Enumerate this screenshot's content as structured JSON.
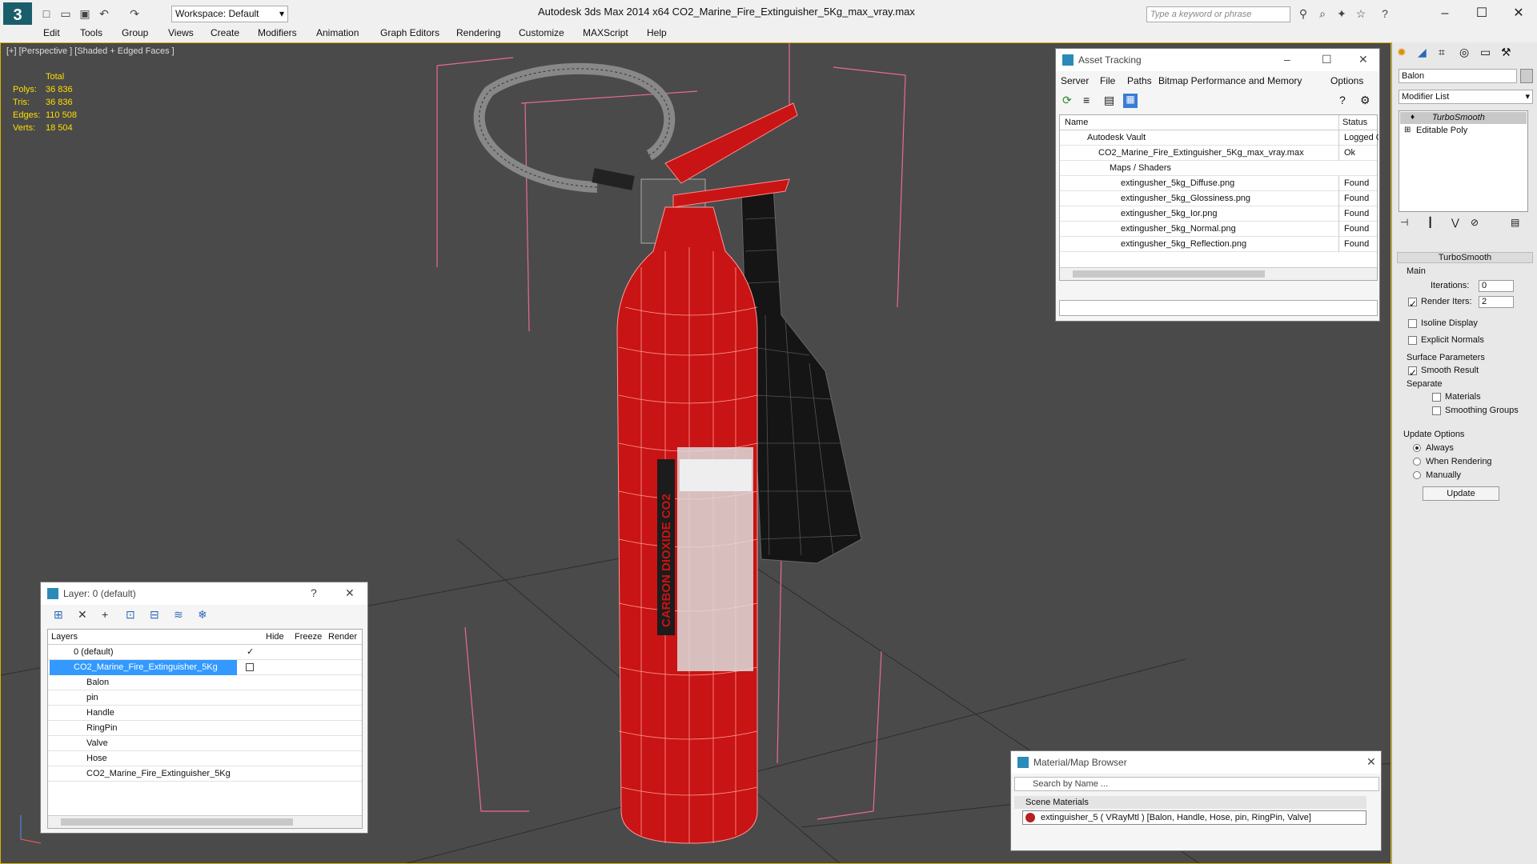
{
  "titlebar": {
    "workspace": "Workspace: Default",
    "title": "Autodesk 3ds Max  2014 x64       CO2_Marine_Fire_Extinguisher_5Kg_max_vray.max",
    "search_placeholder": "Type a keyword or phrase"
  },
  "menu": [
    "Edit",
    "Tools",
    "Group",
    "Views",
    "Create",
    "Modifiers",
    "Animation",
    "Graph Editors",
    "Rendering",
    "Customize",
    "MAXScript",
    "Help"
  ],
  "viewport": {
    "label": "[+] [Perspective ] [Shaded + Edged Faces ]",
    "stats_header": "Total",
    "stats": [
      {
        "label": "Polys:",
        "value": "36 836"
      },
      {
        "label": "Tris:",
        "value": "36 836"
      },
      {
        "label": "Edges:",
        "value": "110 508"
      },
      {
        "label": "Verts:",
        "value": "18 504"
      }
    ],
    "label_text": "CARBON DIOXIDE CO2"
  },
  "asset_tracking": {
    "title": "Asset Tracking",
    "menu": [
      "Server",
      "File",
      "Paths",
      "Bitmap Performance and Memory",
      "Options"
    ],
    "col_name": "Name",
    "col_status": "Status",
    "rows": [
      {
        "name": "Autodesk Vault",
        "status": "Logged O"
      },
      {
        "name": "CO2_Marine_Fire_Extinguisher_5Kg_max_vray.max",
        "status": "Ok"
      },
      {
        "name": "Maps / Shaders",
        "status": ""
      },
      {
        "name": "extingusher_5kg_Diffuse.png",
        "status": "Found"
      },
      {
        "name": "extingusher_5kg_Glossiness.png",
        "status": "Found"
      },
      {
        "name": "extingusher_5kg_Ior.png",
        "status": "Found"
      },
      {
        "name": "extingusher_5kg_Normal.png",
        "status": "Found"
      },
      {
        "name": "extingusher_5kg_Reflection.png",
        "status": "Found"
      }
    ]
  },
  "layer_panel": {
    "title": "Layer: 0 (default)",
    "help": "?",
    "col_layers": "Layers",
    "col_hide": "Hide",
    "col_freeze": "Freeze",
    "col_render": "Render",
    "rows": [
      {
        "name": "0 (default)"
      },
      {
        "name": "CO2_Marine_Fire_Extinguisher_5Kg"
      },
      {
        "name": "Balon"
      },
      {
        "name": "pin"
      },
      {
        "name": "Handle"
      },
      {
        "name": "RingPin"
      },
      {
        "name": "Valve"
      },
      {
        "name": "Hose"
      },
      {
        "name": "CO2_Marine_Fire_Extinguisher_5Kg"
      }
    ]
  },
  "material_browser": {
    "title": "Material/Map Browser",
    "search_placeholder": "Search by Name ...",
    "section": "Scene Materials",
    "item": "extinguisher_5  ( VRayMtl )  [Balon, Handle, Hose, pin, RingPin, Valve]"
  },
  "command_panel": {
    "object_name": "Balon",
    "modifier_list": "Modifier List",
    "stack": [
      "TurboSmooth",
      "Editable Poly"
    ],
    "rollout_title": "TurboSmooth",
    "main_label": "Main",
    "iterations_label": "Iterations:",
    "iterations_value": "0",
    "render_iters_label": "Render Iters:",
    "render_iters_value": "2",
    "isoline": "Isoline Display",
    "explicit_normals": "Explicit Normals",
    "surface_params": "Surface Parameters",
    "smooth_result": "Smooth Result",
    "separate": "Separate",
    "materials": "Materials",
    "smoothing_groups": "Smoothing Groups",
    "update_options": "Update Options",
    "always": "Always",
    "when_rendering": "When Rendering",
    "manually": "Manually",
    "update_button": "Update"
  },
  "colors": {
    "viewport_bg": "#4a4a4a",
    "extinguisher_red": "#c81414",
    "selection_blue": "#3399ff",
    "stats_yellow": "#ffdf00"
  }
}
